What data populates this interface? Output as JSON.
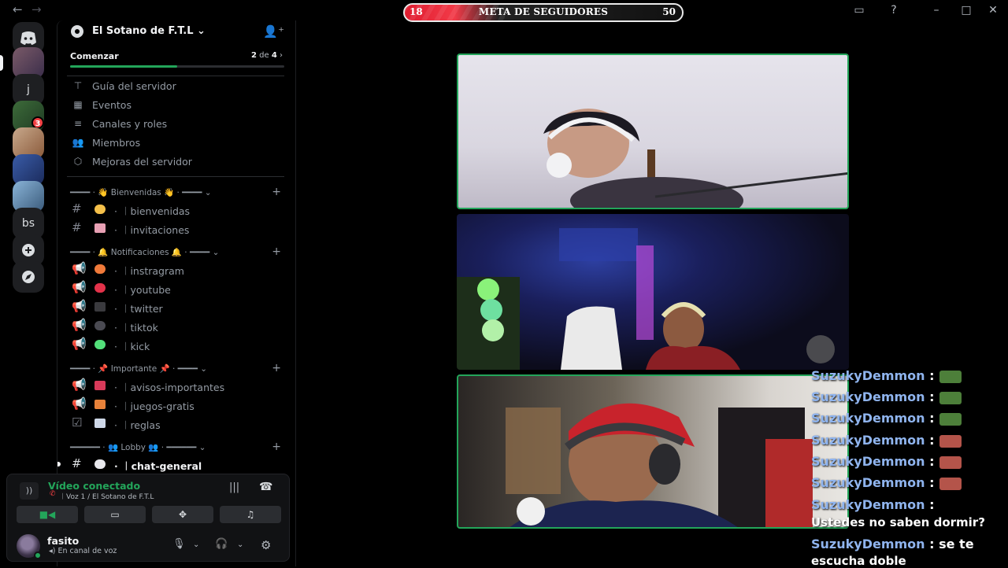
{
  "titlebar": {
    "title": "Sótano de F.T.L",
    "back": "←",
    "forward": "→"
  },
  "goal_bar": {
    "current": "18",
    "label": "META DE SEGUIDORES",
    "target": "50",
    "progress_fraction": 0.36
  },
  "guilds": [
    {
      "label": "",
      "type": "discord-home-icon"
    },
    {
      "label": "",
      "type": "avatar"
    },
    {
      "label": "j",
      "type": "text"
    },
    {
      "label": "",
      "type": "avatar",
      "badge": "3"
    },
    {
      "label": "",
      "type": "avatar"
    },
    {
      "label": "",
      "type": "avatar"
    },
    {
      "label": "",
      "type": "avatar"
    },
    {
      "label": "bs",
      "type": "text"
    },
    {
      "label": "+",
      "type": "add-server-icon"
    },
    {
      "label": "",
      "type": "compass-icon"
    }
  ],
  "server": {
    "name": "El Sotano de F.T.L",
    "progress_label": "Comenzar",
    "progress_done": "2",
    "progress_sep": "de",
    "progress_total": "4",
    "progress_fraction": 0.5
  },
  "server_nav": [
    {
      "label": "Guía del servidor",
      "icon": "signpost-icon"
    },
    {
      "label": "Eventos",
      "icon": "calendar-icon"
    },
    {
      "label": "Canales y roles",
      "icon": "channels-list-icon"
    },
    {
      "label": "Miembros",
      "icon": "members-icon"
    },
    {
      "label": "Mejoras del servidor",
      "icon": "boost-icon"
    }
  ],
  "categories": [
    {
      "label": "━━━━ · 👋 Bienvenidas 👋 · ━━━━ ⌄"
    },
    {
      "label": "━━━━ · 🔔 Notificaciones 🔔 · ━━━━ ⌄"
    },
    {
      "label": "━━━━ · 📌 Importante 📌 · ━━━━ ⌄"
    },
    {
      "label": "━━━━━━ · 👥 Lobby 👥 · ━━━━━━ ⌄"
    }
  ],
  "channels": {
    "bienvenidas": "· ︱bienvenidas",
    "invitaciones": "· ︱invitaciones",
    "instragram": "· ︱instragram",
    "youtube": "· ︱youtube",
    "twitter": "· ︱twitter",
    "tiktok": "· ︱tiktok",
    "kick": "· ︱kick",
    "avisos": "· ︱avisos-importantes",
    "juegos": "· ︱juegos-gratis",
    "reglas": "· ︱reglas",
    "chat_general": "· ︱chat-general"
  },
  "voice": {
    "status": "Vídeo conectado",
    "location": "︱Voz 1 / El Sotano de F.T.L"
  },
  "user": {
    "name": "fasito",
    "status": "En canal de voz"
  },
  "stream_chat": {
    "author": "SuzukyDemmon",
    "colon": ":",
    "message_1": "Ustedes no saben dormir?",
    "message_2": "se te",
    "message_3": "escucha doble",
    "emote_colors": [
      "#4d7f3a",
      "#4d7f3a",
      "#4d7f3a",
      "#b4544a",
      "#b4544a",
      "#b4544a"
    ]
  },
  "colors": {
    "speaking_border": "#23a55a",
    "chat_author": "#8fb4ee",
    "accent_red": "#e01c2f"
  }
}
